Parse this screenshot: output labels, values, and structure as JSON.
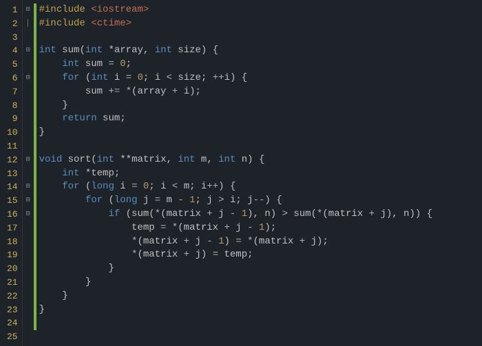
{
  "lines": [
    {
      "n": 1,
      "fold": "⊟",
      "mod": true,
      "tokens": [
        [
          "t-pre",
          "#include "
        ],
        [
          "t-inc",
          "<iostream>"
        ]
      ]
    },
    {
      "n": 2,
      "fold": "│",
      "mod": true,
      "tokens": [
        [
          "t-pre",
          "#include "
        ],
        [
          "t-inc",
          "<ctime>"
        ]
      ]
    },
    {
      "n": 3,
      "fold": "",
      "mod": true,
      "tokens": []
    },
    {
      "n": 4,
      "fold": "⊟",
      "mod": true,
      "tokens": [
        [
          "t-kw",
          "int"
        ],
        [
          "t-id",
          " sum"
        ],
        [
          "t-punc",
          "("
        ],
        [
          "t-kw",
          "int"
        ],
        [
          "t-id",
          " *array"
        ],
        [
          "t-punc",
          ", "
        ],
        [
          "t-kw",
          "int"
        ],
        [
          "t-id",
          " size"
        ],
        [
          "t-punc",
          ") {"
        ]
      ]
    },
    {
      "n": 5,
      "fold": "",
      "mod": true,
      "tokens": [
        [
          "t-id",
          "    "
        ],
        [
          "t-kw",
          "int"
        ],
        [
          "t-id",
          " sum "
        ],
        [
          "t-op",
          "= "
        ],
        [
          "t-num",
          "0"
        ],
        [
          "t-punc",
          ";"
        ]
      ]
    },
    {
      "n": 6,
      "fold": "⊟",
      "mod": true,
      "tokens": [
        [
          "t-id",
          "    "
        ],
        [
          "t-kw",
          "for"
        ],
        [
          "t-punc",
          " ("
        ],
        [
          "t-kw",
          "int"
        ],
        [
          "t-id",
          " i "
        ],
        [
          "t-op",
          "= "
        ],
        [
          "t-num",
          "0"
        ],
        [
          "t-punc",
          "; i "
        ],
        [
          "t-op",
          "< "
        ],
        [
          "t-id",
          "size"
        ],
        [
          "t-punc",
          "; "
        ],
        [
          "t-op",
          "++"
        ],
        [
          "t-id",
          "i"
        ],
        [
          "t-punc",
          ") {"
        ]
      ]
    },
    {
      "n": 7,
      "fold": "",
      "mod": true,
      "tokens": [
        [
          "t-id",
          "        sum "
        ],
        [
          "t-op",
          "+= *"
        ],
        [
          "t-punc",
          "("
        ],
        [
          "t-id",
          "array "
        ],
        [
          "t-op",
          "+ "
        ],
        [
          "t-id",
          "i"
        ],
        [
          "t-punc",
          ");"
        ]
      ]
    },
    {
      "n": 8,
      "fold": "",
      "mod": true,
      "tokens": [
        [
          "t-punc",
          "    }"
        ]
      ]
    },
    {
      "n": 9,
      "fold": "",
      "mod": true,
      "tokens": [
        [
          "t-id",
          "    "
        ],
        [
          "t-kw",
          "return"
        ],
        [
          "t-id",
          " sum"
        ],
        [
          "t-punc",
          ";"
        ]
      ]
    },
    {
      "n": 10,
      "fold": "",
      "mod": true,
      "tokens": [
        [
          "t-punc",
          "}"
        ]
      ]
    },
    {
      "n": 11,
      "fold": "",
      "mod": true,
      "tokens": []
    },
    {
      "n": 12,
      "fold": "⊟",
      "mod": true,
      "tokens": [
        [
          "t-kw",
          "void"
        ],
        [
          "t-id",
          " sort"
        ],
        [
          "t-punc",
          "("
        ],
        [
          "t-kw",
          "int"
        ],
        [
          "t-id",
          " **matrix"
        ],
        [
          "t-punc",
          ", "
        ],
        [
          "t-kw",
          "int"
        ],
        [
          "t-id",
          " m"
        ],
        [
          "t-punc",
          ", "
        ],
        [
          "t-kw",
          "int"
        ],
        [
          "t-id",
          " n"
        ],
        [
          "t-punc",
          ") {"
        ]
      ]
    },
    {
      "n": 13,
      "fold": "",
      "mod": true,
      "tokens": [
        [
          "t-id",
          "    "
        ],
        [
          "t-kw",
          "int"
        ],
        [
          "t-id",
          " *temp"
        ],
        [
          "t-punc",
          ";"
        ]
      ]
    },
    {
      "n": 14,
      "fold": "⊟",
      "mod": true,
      "tokens": [
        [
          "t-id",
          "    "
        ],
        [
          "t-kw",
          "for"
        ],
        [
          "t-punc",
          " ("
        ],
        [
          "t-kw",
          "long"
        ],
        [
          "t-id",
          " i "
        ],
        [
          "t-op",
          "= "
        ],
        [
          "t-num",
          "0"
        ],
        [
          "t-punc",
          "; i "
        ],
        [
          "t-op",
          "< "
        ],
        [
          "t-id",
          "m"
        ],
        [
          "t-punc",
          "; i"
        ],
        [
          "t-op",
          "++"
        ],
        [
          "t-punc",
          ") {"
        ]
      ]
    },
    {
      "n": 15,
      "fold": "⊟",
      "mod": true,
      "tokens": [
        [
          "t-id",
          "        "
        ],
        [
          "t-kw",
          "for"
        ],
        [
          "t-punc",
          " ("
        ],
        [
          "t-kw",
          "long"
        ],
        [
          "t-id",
          " j "
        ],
        [
          "t-op",
          "= "
        ],
        [
          "t-id",
          "m "
        ],
        [
          "t-op",
          "- "
        ],
        [
          "t-num",
          "1"
        ],
        [
          "t-punc",
          "; j "
        ],
        [
          "t-op",
          "> "
        ],
        [
          "t-id",
          "i"
        ],
        [
          "t-punc",
          "; j"
        ],
        [
          "t-op",
          "--"
        ],
        [
          "t-punc",
          ") {"
        ]
      ]
    },
    {
      "n": 16,
      "fold": "⊟",
      "mod": true,
      "tokens": [
        [
          "t-id",
          "            "
        ],
        [
          "t-kw",
          "if"
        ],
        [
          "t-punc",
          " (sum("
        ],
        [
          "t-op",
          "*"
        ],
        [
          "t-punc",
          "(matrix "
        ],
        [
          "t-op",
          "+ "
        ],
        [
          "t-id",
          "j "
        ],
        [
          "t-op",
          "- "
        ],
        [
          "t-num",
          "1"
        ],
        [
          "t-punc",
          "), n) "
        ],
        [
          "t-op",
          "> "
        ],
        [
          "t-id",
          "sum"
        ],
        [
          "t-punc",
          "("
        ],
        [
          "t-op",
          "*"
        ],
        [
          "t-punc",
          "(matrix "
        ],
        [
          "t-op",
          "+ "
        ],
        [
          "t-id",
          "j"
        ],
        [
          "t-punc",
          "), n)) {"
        ]
      ]
    },
    {
      "n": 17,
      "fold": "",
      "mod": true,
      "tokens": [
        [
          "t-id",
          "                temp "
        ],
        [
          "t-op",
          "= *"
        ],
        [
          "t-punc",
          "(matrix "
        ],
        [
          "t-op",
          "+ "
        ],
        [
          "t-id",
          "j "
        ],
        [
          "t-op",
          "- "
        ],
        [
          "t-num",
          "1"
        ],
        [
          "t-punc",
          ");"
        ]
      ]
    },
    {
      "n": 18,
      "fold": "",
      "mod": true,
      "tokens": [
        [
          "t-id",
          "                "
        ],
        [
          "t-op",
          "*"
        ],
        [
          "t-punc",
          "(matrix "
        ],
        [
          "t-op",
          "+ "
        ],
        [
          "t-id",
          "j "
        ],
        [
          "t-op",
          "- "
        ],
        [
          "t-num",
          "1"
        ],
        [
          "t-punc",
          ") "
        ],
        [
          "t-op",
          "= *"
        ],
        [
          "t-punc",
          "(matrix "
        ],
        [
          "t-op",
          "+ "
        ],
        [
          "t-id",
          "j"
        ],
        [
          "t-punc",
          ");"
        ]
      ]
    },
    {
      "n": 19,
      "fold": "",
      "mod": true,
      "tokens": [
        [
          "t-id",
          "                "
        ],
        [
          "t-op",
          "*"
        ],
        [
          "t-punc",
          "(matrix "
        ],
        [
          "t-op",
          "+ "
        ],
        [
          "t-id",
          "j"
        ],
        [
          "t-punc",
          ") "
        ],
        [
          "t-op",
          "= "
        ],
        [
          "t-id",
          "temp"
        ],
        [
          "t-punc",
          ";"
        ]
      ]
    },
    {
      "n": 20,
      "fold": "",
      "mod": true,
      "tokens": [
        [
          "t-punc",
          "            }"
        ]
      ]
    },
    {
      "n": 21,
      "fold": "",
      "mod": true,
      "tokens": [
        [
          "t-punc",
          "        }"
        ]
      ]
    },
    {
      "n": 22,
      "fold": "",
      "mod": true,
      "tokens": [
        [
          "t-punc",
          "    }"
        ]
      ]
    },
    {
      "n": 23,
      "fold": "",
      "mod": true,
      "tokens": [
        [
          "t-punc",
          "}"
        ]
      ]
    },
    {
      "n": 24,
      "fold": "",
      "mod": true,
      "tokens": []
    },
    {
      "n": 25,
      "fold": "",
      "mod": false,
      "tokens": []
    }
  ]
}
